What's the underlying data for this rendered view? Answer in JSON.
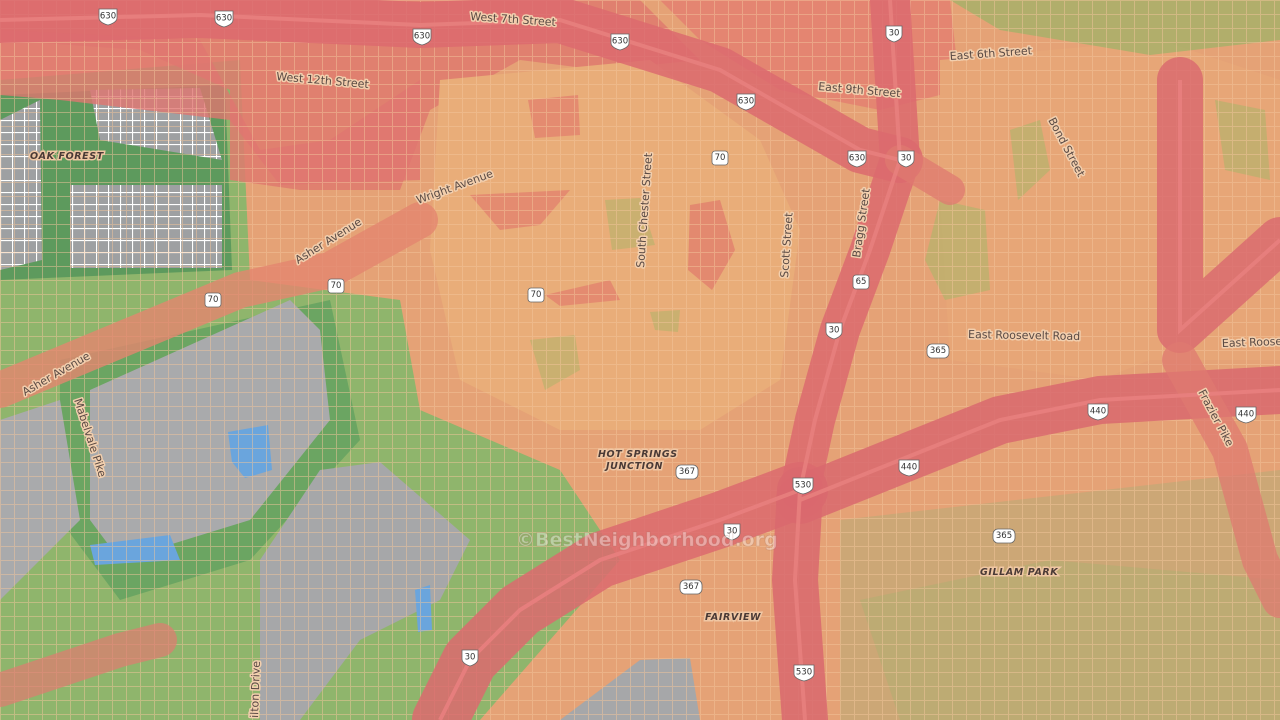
{
  "watermark": "©BestNeighborhood.org",
  "palette": {
    "high": "#e06e6e",
    "elevated": "#e88f73",
    "moderate": "#e8a97a",
    "low": "#9fb46c",
    "lowest": "#6fa664",
    "industrial": "#b8b8b8",
    "water": "#6aa5dd",
    "streets": "#f3c49a"
  },
  "streets": {
    "west_7th": "West 7th Street",
    "west_12th": "West 12th Street",
    "east_6th": "East 6th Street",
    "east_9th": "East 9th Street",
    "bond": "Bond Street",
    "wright": "Wright Avenue",
    "asher_1": "Asher Avenue",
    "asher_2": "Asher Avenue",
    "south_chester": "South Chester Street",
    "scott": "Scott Street",
    "bragg": "Bragg Street",
    "roosevelt_1": "East Roosevelt Road",
    "roosevelt_2": "East Roose",
    "frazier": "Frazier Pike",
    "mabelvale": "Mabelvale Pike",
    "hilton": "ilton Drive"
  },
  "places": {
    "oak_forest": "OAK FOREST",
    "hsj_1": "HOT SPRINGS",
    "hsj_2": "JUNCTION",
    "gillam": "GILLAM PARK",
    "fairview": "FAIRVIEW"
  },
  "shields": {
    "i630a": "630",
    "i630b": "630",
    "i630c": "630",
    "i630d": "630",
    "i630e": "630",
    "i30a": "30",
    "i30b": "30",
    "i30c": "30",
    "i30d": "30",
    "i30e": "30",
    "us70a": "70",
    "us70b": "70",
    "us70c": "70",
    "us70d": "70",
    "us65": "65",
    "i440a": "440",
    "i440b": "440",
    "i440c": "440",
    "ar365a": "365",
    "ar365b": "365",
    "ar367a": "367",
    "ar367b": "367",
    "i530a": "530",
    "i530b": "530"
  }
}
